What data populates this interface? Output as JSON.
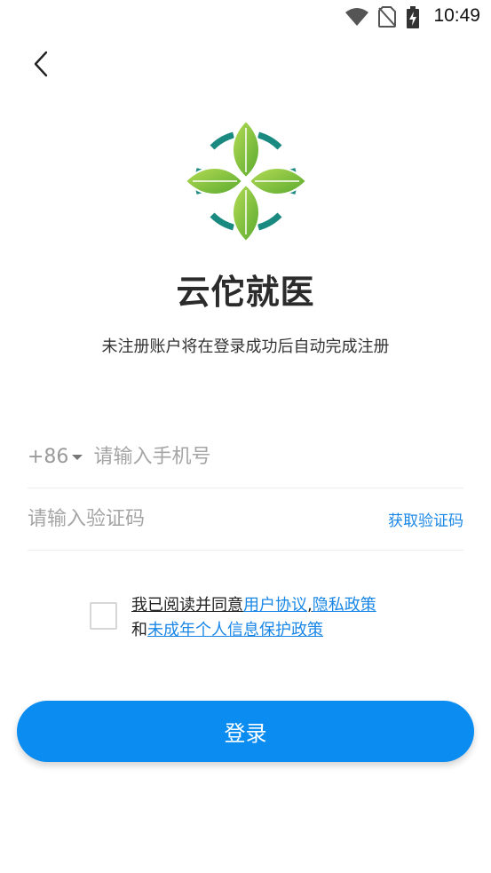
{
  "status_bar": {
    "time": "10:49",
    "icons": [
      "wifi-icon",
      "no-sim-icon",
      "battery-charging-icon"
    ]
  },
  "header": {
    "back_icon": "chevron-left-icon"
  },
  "app": {
    "name": "云佗就医",
    "logo_icon": "four-leaf-logo",
    "subtitle": "未注册账户将在登录成功后自动完成注册"
  },
  "form": {
    "country_code": "+86",
    "phone_placeholder": "请输入手机号",
    "code_placeholder": "请输入验证码",
    "get_code_label": "获取验证码"
  },
  "agreement": {
    "prefix": "我已阅读并同意",
    "user_agreement": "用户协议",
    "separator": ",",
    "privacy_policy": "隐私政策",
    "and": "和",
    "minor_policy": "未成年个人信息保护政策"
  },
  "login": {
    "label": "登录"
  },
  "colors": {
    "accent": "#0a8cf0",
    "link": "#1a87e6",
    "leaf_green": "#7fc141",
    "ring_teal": "#1a8a80"
  }
}
